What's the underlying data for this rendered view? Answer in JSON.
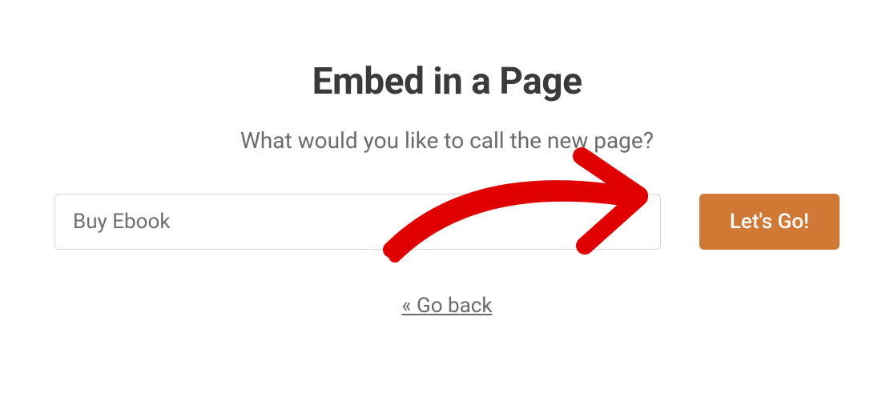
{
  "title": "Embed in a Page",
  "subtitle": "What would you like to call the new page?",
  "input": {
    "value": "Buy Ebook",
    "placeholder": ""
  },
  "button": {
    "label": "Let's Go!"
  },
  "back_link": {
    "label": "« Go back"
  },
  "annotation": {
    "type": "arrow",
    "color": "#e10000"
  }
}
